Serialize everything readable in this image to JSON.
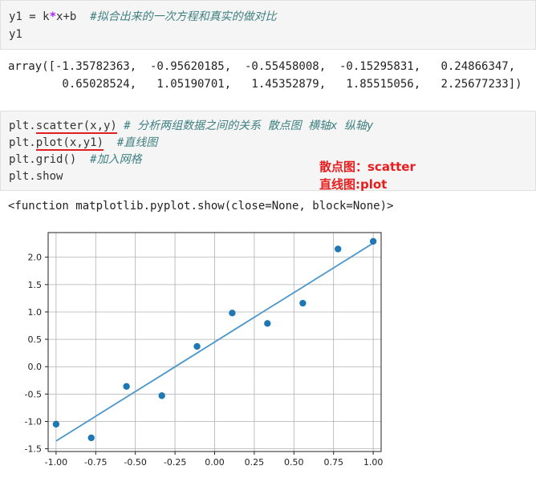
{
  "cell1": {
    "line1": {
      "var": "y1 = ",
      "k": "k",
      "op": "*",
      "rest": "x+b  ",
      "comment": "#拟合出来的一次方程和真实的做对比"
    },
    "line2": "y1"
  },
  "output1": {
    "line1": "array([-1.35782363,  -0.95620185,  -0.55458008,  -0.15295831,   0.24866347,",
    "line2": "        0.65028524,   1.05190701,   1.45352879,   1.85515056,   2.25677233])"
  },
  "cell2": {
    "line1": {
      "prefix": "plt.",
      "call": "scatter(x,y)",
      "comment": " # 分析两组数据之间的关系 散点图 横轴x 纵轴y"
    },
    "line2": {
      "prefix": "plt.",
      "call": "plot(x,y1)",
      "comment": "  #直线图"
    },
    "line3": {
      "code": "plt.grid() ",
      "comment": " #加入网格"
    },
    "line4": "plt.show"
  },
  "annotation": {
    "line1": "散点图：scatter",
    "line2": "直线图:plot"
  },
  "output2": "<function matplotlib.pyplot.show(close=None, block=None)>",
  "colors": {
    "series": "#1f77b4",
    "line": "#4c97c9",
    "annotation": "#e81c1c",
    "underline": "#e02020"
  },
  "chart_data": {
    "type": "scatter",
    "grid": true,
    "xlim": [
      -1.05,
      1.05
    ],
    "ylim": [
      -1.55,
      2.45
    ],
    "xticks": [
      "-1.00",
      "-0.75",
      "-0.50",
      "-0.25",
      "0.00",
      "0.25",
      "0.50",
      "0.75",
      "1.00"
    ],
    "xtick_values": [
      -1.0,
      -0.75,
      -0.5,
      -0.25,
      0.0,
      0.25,
      0.5,
      0.75,
      1.0
    ],
    "yticks": [
      "-1.5",
      "-1.0",
      "-0.5",
      "0.0",
      "0.5",
      "1.0",
      "1.5",
      "2.0"
    ],
    "ytick_values": [
      -1.5,
      -1.0,
      -0.5,
      0.0,
      0.5,
      1.0,
      1.5,
      2.0
    ],
    "scatter": {
      "x": [
        -1.0,
        -0.778,
        -0.556,
        -0.333,
        -0.111,
        0.111,
        0.333,
        0.556,
        0.778,
        1.0
      ],
      "y": [
        -1.05,
        -1.3,
        -0.36,
        -0.53,
        0.37,
        0.98,
        0.79,
        1.16,
        2.15,
        2.29
      ]
    },
    "line": {
      "x": [
        -1.0,
        -0.778,
        -0.556,
        -0.333,
        -0.111,
        0.111,
        0.333,
        0.556,
        0.778,
        1.0
      ],
      "y": [
        -1.35782363,
        -0.95620185,
        -0.55458008,
        -0.15295831,
        0.24866347,
        0.65028524,
        1.05190701,
        1.45352879,
        1.85515056,
        2.25677233
      ]
    }
  }
}
